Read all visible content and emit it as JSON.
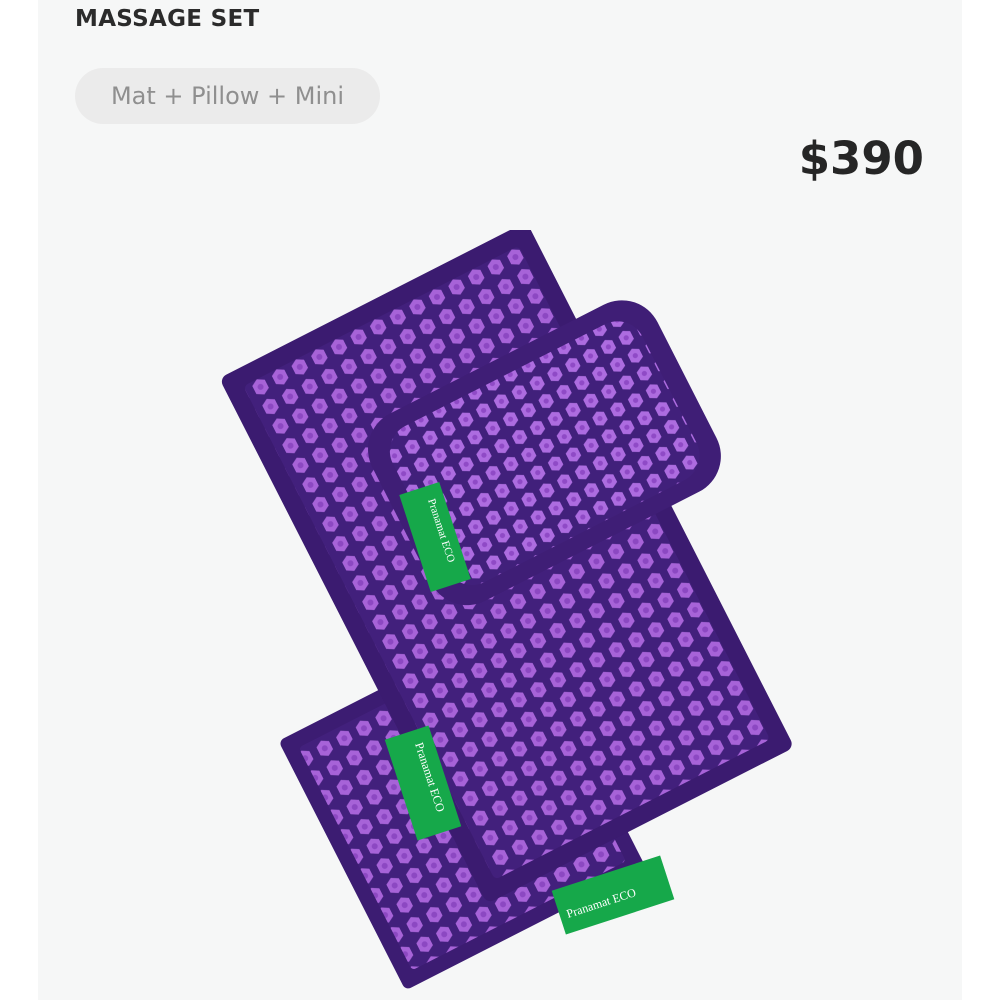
{
  "product": {
    "title": "MASSAGE SET",
    "variant_label": "Mat + Pillow + Mini",
    "price": "$390"
  },
  "image": {
    "tag_text": "Pranamat ECO",
    "colors": {
      "mat": "#3f1e78",
      "mat_border": "#5a32a0",
      "flower": "#a560d6",
      "tag": "#16a84a"
    }
  }
}
